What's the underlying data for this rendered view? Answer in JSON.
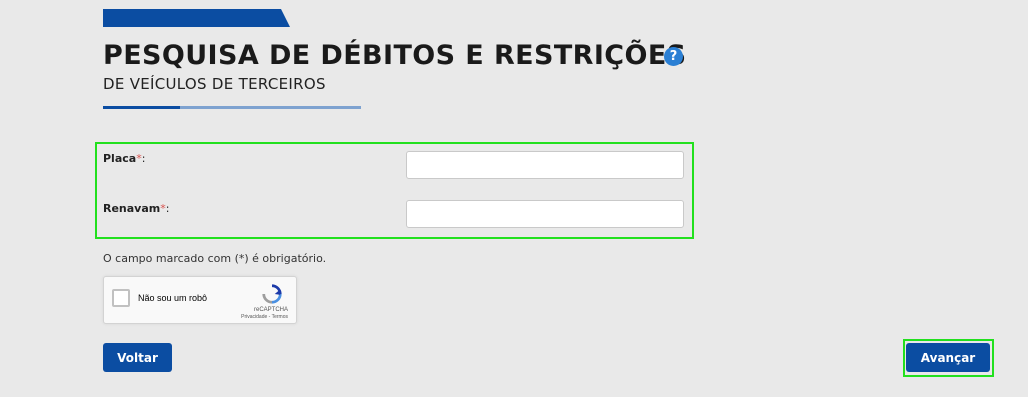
{
  "page": {
    "title": "PESQUISA DE DÉBITOS E RESTRIÇÕES",
    "subtitle": "DE VEÍCULOS DE TERCEIROS",
    "help_icon": "?"
  },
  "form": {
    "fields": [
      {
        "label": "Placa",
        "required_mark": "*",
        "suffix": ":",
        "value": ""
      },
      {
        "label": "Renavam",
        "required_mark": "*",
        "suffix": ":",
        "value": ""
      }
    ],
    "required_note": "O campo marcado com (*) é obrigatório."
  },
  "captcha": {
    "label": "Não sou um robô",
    "brand": "reCAPTCHA",
    "links": "Privacidade - Termos",
    "checked": false
  },
  "buttons": {
    "back_label": "Voltar",
    "next_label": "Avançar"
  },
  "colors": {
    "primary": "#0b4da2",
    "highlight": "#22e01e",
    "required": "#d9534f",
    "background": "#e9e9e9"
  }
}
